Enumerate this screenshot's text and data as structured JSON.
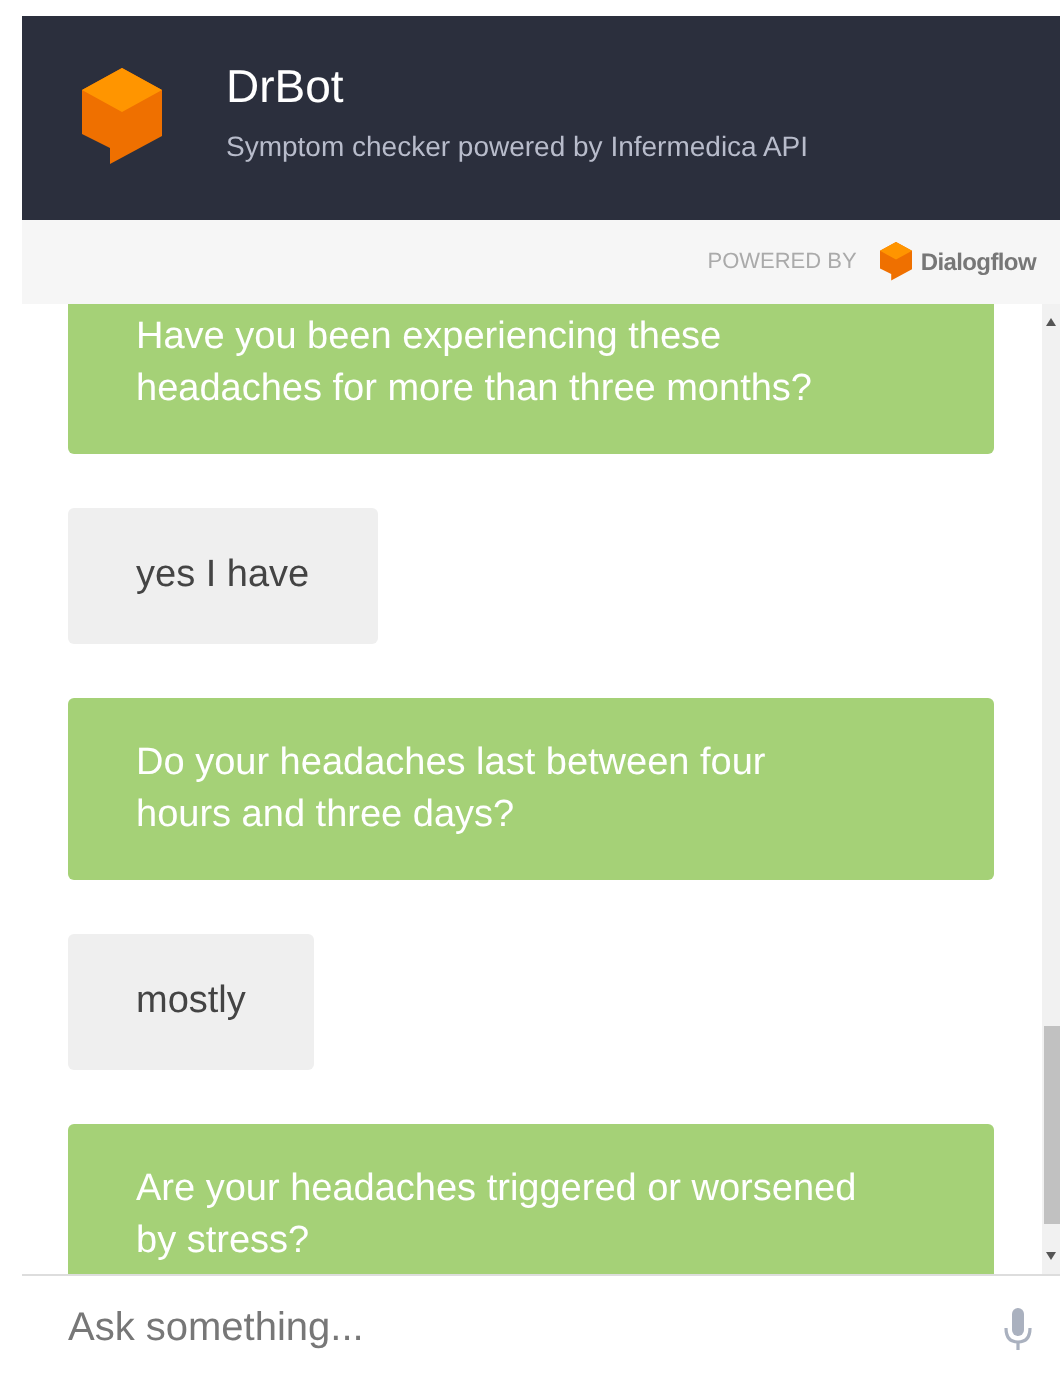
{
  "header": {
    "title": "DrBot",
    "subtitle": "Symptom checker powered by Infermedica API"
  },
  "powered_by": {
    "label": "POWERED BY",
    "brand": "Dialogflow"
  },
  "messages": [
    {
      "kind": "bot",
      "text": "Have you been experiencing these headaches for more than three months?"
    },
    {
      "kind": "user",
      "text": "yes I have"
    },
    {
      "kind": "bot",
      "text": "Do your headaches last between four hours and three days?"
    },
    {
      "kind": "user",
      "text": "mostly"
    },
    {
      "kind": "bot",
      "text": "Are your headaches triggered or worsened by stress?"
    }
  ],
  "input": {
    "placeholder": "Ask something..."
  }
}
